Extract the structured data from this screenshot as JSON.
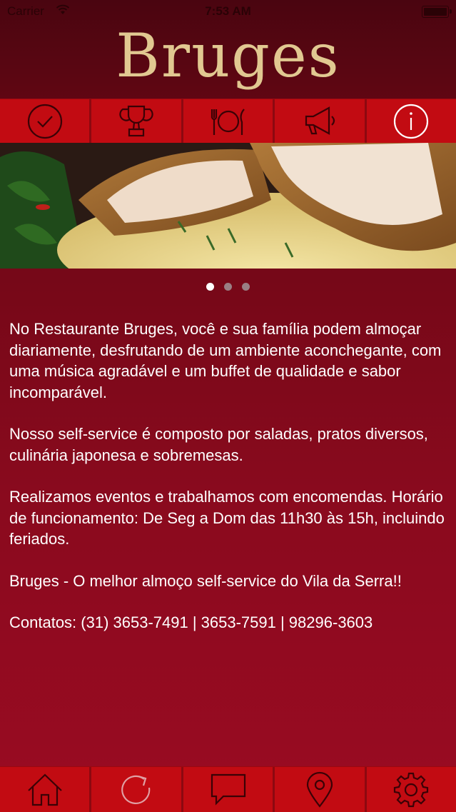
{
  "status_bar": {
    "carrier": "Carrier",
    "time": "7:53 AM"
  },
  "app": {
    "logo_text": "Bruges",
    "logo_color": "#e1c891",
    "accent_color": "#c20b12"
  },
  "top_nav": [
    {
      "icon": "check-circle-icon"
    },
    {
      "icon": "trophy-icon"
    },
    {
      "icon": "plate-cutlery-icon"
    },
    {
      "icon": "megaphone-icon"
    },
    {
      "icon": "info-icon"
    }
  ],
  "carousel": {
    "image": "banner-food-photo",
    "pages": 3,
    "active_page": 1
  },
  "content": {
    "paragraphs": [
      "No Restaurante Bruges, você e sua família podem almoçar diariamente, desfrutando de um ambiente aconchegante, com uma música agradável e um buffet de qualidade e sabor incomparável.",
      "Nosso self-service é composto por saladas, pratos diversos, culinária japonesa e sobremesas.",
      "Realizamos eventos e trabalhamos com encomendas. Horário de funcionamento: De Seg a Dom das 11h30 às 15h, incluindo feriados.",
      "Bruges - O melhor almoço self-service do Vila da Serra!!",
      "Contatos: (31) 3653-7491 | 3653-7591 | 98296-3603"
    ]
  },
  "bottom_nav": [
    {
      "icon": "home-icon"
    },
    {
      "icon": "refresh-icon"
    },
    {
      "icon": "chat-icon"
    },
    {
      "icon": "location-pin-icon"
    },
    {
      "icon": "settings-gear-icon"
    }
  ]
}
